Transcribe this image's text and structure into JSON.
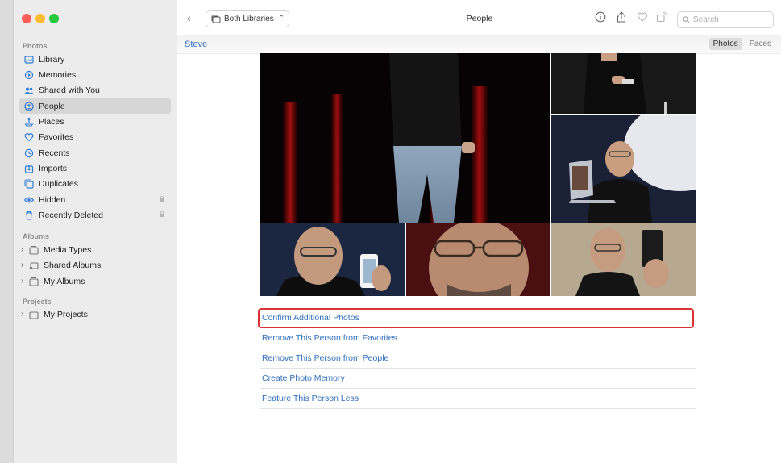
{
  "sidebar": {
    "section_photos": "Photos",
    "items": [
      {
        "label": "Library",
        "icon": "library-icon"
      },
      {
        "label": "Memories",
        "icon": "memories-icon"
      },
      {
        "label": "Shared with You",
        "icon": "shared-with-you-icon"
      },
      {
        "label": "People",
        "icon": "people-icon",
        "active": true
      },
      {
        "label": "Places",
        "icon": "places-icon"
      },
      {
        "label": "Favorites",
        "icon": "heart-icon"
      },
      {
        "label": "Recents",
        "icon": "recents-icon"
      },
      {
        "label": "Imports",
        "icon": "imports-icon"
      },
      {
        "label": "Duplicates",
        "icon": "duplicates-icon"
      },
      {
        "label": "Hidden",
        "icon": "eye-icon",
        "locked": true
      },
      {
        "label": "Recently Deleted",
        "icon": "trash-icon",
        "locked": true
      }
    ],
    "section_albums": "Albums",
    "albums": [
      {
        "label": "Media Types"
      },
      {
        "label": "Shared Albums"
      },
      {
        "label": "My Albums"
      }
    ],
    "section_projects": "Projects",
    "projects": [
      {
        "label": "My Projects"
      }
    ]
  },
  "toolbar": {
    "library_selector": "Both Libraries",
    "title": "People",
    "search_placeholder": "Search"
  },
  "subbar": {
    "person_name": "Steve",
    "seg_photos": "Photos",
    "seg_faces": "Faces"
  },
  "actions": [
    "Confirm Additional Photos",
    "Remove This Person from Favorites",
    "Remove This Person from People",
    "Create Photo Memory",
    "Feature This Person Less"
  ],
  "colors": {
    "accent": "#2f6fbd",
    "highlight": "#d83232",
    "sidebar_bg": "#ececec"
  }
}
